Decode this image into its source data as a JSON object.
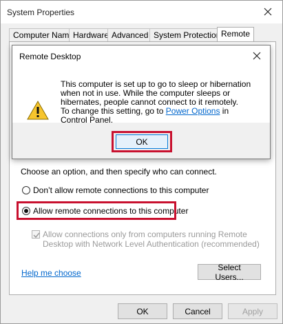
{
  "window": {
    "title": "System Properties"
  },
  "tabs": [
    {
      "label": "Computer Name"
    },
    {
      "label": "Hardware"
    },
    {
      "label": "Advanced"
    },
    {
      "label": "System Protection"
    },
    {
      "label": "Remote"
    }
  ],
  "dialog": {
    "title": "Remote Desktop",
    "message_line1": "This computer is set up to go to sleep or hibernation",
    "message_line2": "when not in use. While the computer sleeps or",
    "message_line3": "hibernates, people cannot connect to it remotely.",
    "message_line4_prefix": "To change this setting, go to ",
    "message_link": "Power Options",
    "message_line4_suffix": " in",
    "message_line5": "Control Panel.",
    "ok_label": "OK",
    "icon": "warning-icon"
  },
  "remote_desktop": {
    "instruction": "Choose an option, and then specify who can connect.",
    "option_dont_allow": "Don’t allow remote connections to this computer",
    "option_allow": "Allow remote connections to this computer",
    "selected_option": "allow",
    "nla_line1": "Allow connections only from computers running Remote",
    "nla_line2": "Desktop with Network Level Authentication (recommended)",
    "nla_checked": true,
    "help_link": "Help me choose",
    "select_users_label": "Select Users..."
  },
  "footer": {
    "ok_label": "OK",
    "cancel_label": "Cancel",
    "apply_label": "Apply"
  },
  "colors": {
    "highlight": "#c8102e",
    "link": "#0066cc"
  }
}
